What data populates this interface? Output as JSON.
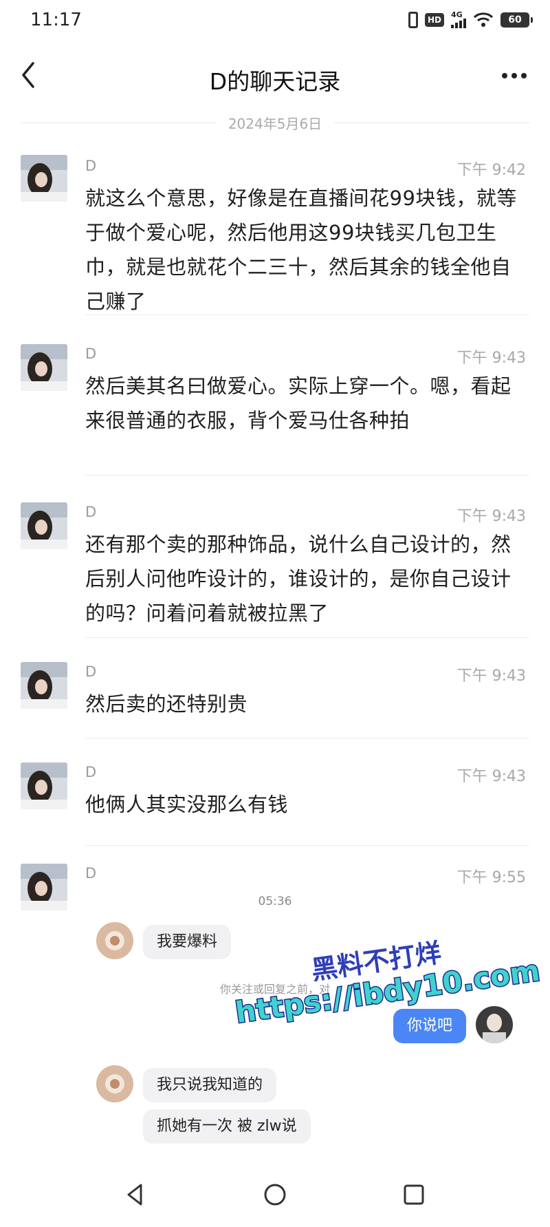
{
  "status_bar": {
    "time": "11:17",
    "network": "4G",
    "hd": "HD",
    "battery": "60"
  },
  "header": {
    "title": "D的聊天记录"
  },
  "date_divider": "2024年5月6日",
  "messages": [
    {
      "sender": "D",
      "time": "下午 9:42",
      "text": "就这么个意思，好像是在直播间花99块钱，就等于做个爱心呢，然后他用这99块钱买几包卫生巾，就是也就花个二三十，然后其余的钱全他自己赚了"
    },
    {
      "sender": "D",
      "time": "下午 9:43",
      "text": "然后美其名曰做爱心。实际上穿一个。嗯，看起来很普通的衣服，背个爱马仕各种拍"
    },
    {
      "sender": "D",
      "time": "下午 9:43",
      "text": "还有那个卖的那种饰品，说什么自己设计的，然后别人问他咋设计的，谁设计的，是你自己设计的吗？问着问着就被拉黑了"
    },
    {
      "sender": "D",
      "time": "下午 9:43",
      "text": "然后卖的还特别贵"
    },
    {
      "sender": "D",
      "time": "下午 9:43",
      "text": "他俩人其实没那么有钱"
    },
    {
      "sender": "D",
      "time": "下午 9:55",
      "text": ""
    }
  ],
  "embedded_chat": {
    "time": "05:36",
    "bubble1": "我要爆料",
    "notice": "你关注或回复之前，对",
    "reply": "你说吧",
    "bubble2": "我只说我知道的",
    "bubble3": "抓她有一次 被 zlw说"
  },
  "watermark": {
    "line1": "黑料不打烊",
    "line2": "https://ibdy10.com"
  }
}
